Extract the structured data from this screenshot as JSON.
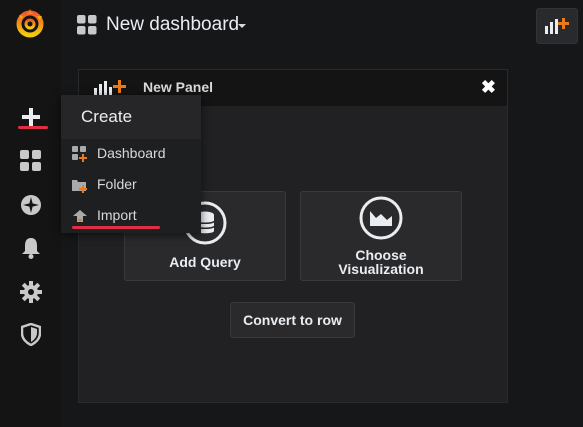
{
  "topbar": {
    "title": "New dashboard"
  },
  "sidebar": {
    "items": [
      {
        "name": "create",
        "icon": "plus-icon"
      },
      {
        "name": "dashboards",
        "icon": "grid-icon"
      },
      {
        "name": "explore",
        "icon": "compass-icon"
      },
      {
        "name": "alerting",
        "icon": "bell-icon"
      },
      {
        "name": "configuration",
        "icon": "gear-icon"
      },
      {
        "name": "server-admin",
        "icon": "shield-icon"
      }
    ]
  },
  "create_menu": {
    "title": "Create",
    "items": [
      {
        "label": "Dashboard",
        "icon": "dashboard-add-icon"
      },
      {
        "label": "Folder",
        "icon": "folder-add-icon"
      },
      {
        "label": "Import",
        "icon": "import-icon"
      }
    ]
  },
  "panel": {
    "title": "New Panel",
    "add_query_label": "Add Query",
    "choose_vis_label_line1": "Choose",
    "choose_vis_label_line2": "Visualization",
    "convert_label": "Convert to row"
  },
  "colors": {
    "accent": "#eb7b18",
    "highlight": "#e02f44",
    "background": "#161719"
  }
}
